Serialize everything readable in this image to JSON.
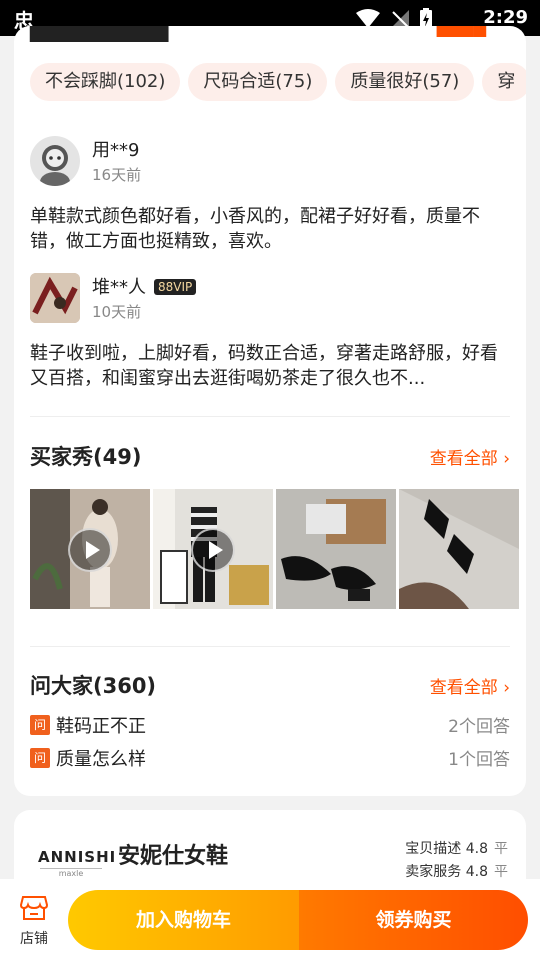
{
  "status_bar": {
    "time": "2:29",
    "app_icon": "app-logo-icon"
  },
  "reviews": {
    "tags": [
      "不会踩脚(102)",
      "尺码合适(75)",
      "质量很好(57)",
      "穿"
    ],
    "items": [
      {
        "user": "用**9",
        "date": "16天前",
        "vip": "",
        "text": "单鞋款式颜色都好看，小香风的，配裙子好好看，质量不错，做工方面也挺精致，喜欢。"
      },
      {
        "user": "堆**人",
        "date": "10天前",
        "vip": "88VIP",
        "text": "鞋子收到啦，上脚好看，码数正合适，穿著走路舒服，好看又百搭，和闺蜜穿出去逛街喝奶茶走了很久也不..."
      }
    ]
  },
  "buyer_show": {
    "title": "买家秀(49)",
    "link": "查看全部"
  },
  "ask": {
    "title": "问大家(360)",
    "link": "查看全部",
    "icon_label": "问",
    "questions": [
      {
        "text": "鞋码正不正",
        "answers": "2个回答"
      },
      {
        "text": "质量怎么样",
        "answers": "1个回答"
      }
    ]
  },
  "shop": {
    "logo": "ANNISHI",
    "logo_sub": "maxle",
    "name": "安妮仕女鞋",
    "scores": [
      {
        "label": "宝贝描述",
        "value": "4.8",
        "level": "平"
      },
      {
        "label": "卖家服务",
        "value": "4.8",
        "level": "平"
      }
    ]
  },
  "bottom_bar": {
    "store_label": "店铺",
    "cart_label": "加入购物车",
    "buy_label": "领券购买"
  }
}
